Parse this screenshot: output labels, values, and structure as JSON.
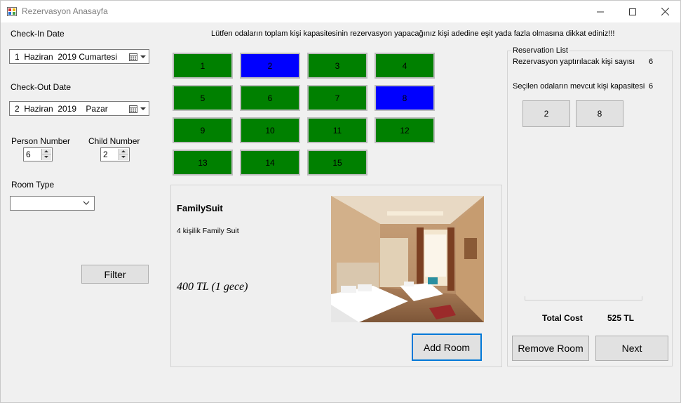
{
  "window": {
    "title": "Rezervasyon Anasayfa"
  },
  "filters": {
    "checkin_label": "Check-In Date",
    "checkin_value": "1  Haziran  2019 Cumartesi",
    "checkout_label": "Check-Out Date",
    "checkout_value": "2  Haziran  2019    Pazar",
    "person_label": "Person Number",
    "person_value": "6",
    "child_label": "Child Number",
    "child_value": "2",
    "room_type_label": "Room Type",
    "room_type_value": "",
    "filter_button": "Filter"
  },
  "notice": "Lütfen odaların toplam kişi kapasitesinin rezervasyon yapacağınız kişi adedine eşit yada fazla olmasına dikkat ediniz!!!",
  "rooms": [
    {
      "number": "1",
      "status": "available"
    },
    {
      "number": "2",
      "status": "selected"
    },
    {
      "number": "3",
      "status": "available"
    },
    {
      "number": "4",
      "status": "available"
    },
    {
      "number": "5",
      "status": "available"
    },
    {
      "number": "6",
      "status": "available"
    },
    {
      "number": "7",
      "status": "available"
    },
    {
      "number": "8",
      "status": "selected"
    },
    {
      "number": "9",
      "status": "available"
    },
    {
      "number": "10",
      "status": "available"
    },
    {
      "number": "11",
      "status": "available"
    },
    {
      "number": "12",
      "status": "available"
    },
    {
      "number": "13",
      "status": "available"
    },
    {
      "number": "14",
      "status": "available"
    },
    {
      "number": "15",
      "status": "available"
    }
  ],
  "colors": {
    "available": "#008000",
    "selected": "#0000ff",
    "accent": "#0078d7"
  },
  "room_detail": {
    "name": "FamilySuit",
    "description": "4 kişilik Family Suit",
    "price": "400 TL (1 gece)",
    "add_button": "Add Room"
  },
  "reservation": {
    "group_title": "Reservation List",
    "person_count_label": "Rezervasyon yaptırılacak kişi sayısı",
    "person_count_value": "6",
    "capacity_label": "Seçilen odaların mevcut kişi kapasitesi",
    "capacity_value": "6",
    "selected_rooms": [
      "2",
      "8"
    ],
    "total_label": "Total Cost",
    "total_value": "525 TL",
    "remove_button": "Remove Room",
    "next_button": "Next"
  }
}
